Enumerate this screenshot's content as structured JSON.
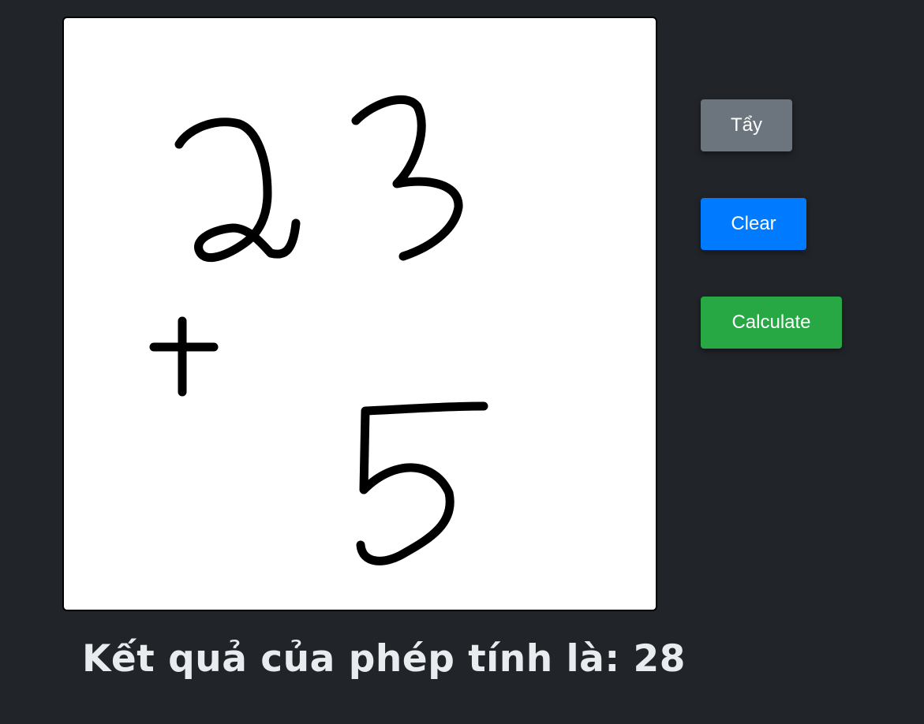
{
  "toolbar": {
    "eraser_label": "Tẩy",
    "clear_label": "Clear",
    "calculate_label": "Calculate"
  },
  "result": {
    "text": "Kết quả của phép tính là: 28"
  },
  "colors": {
    "background": "#212429",
    "canvas": "#ffffff",
    "ink": "#000000",
    "eraser_button": "#6c757d",
    "clear_button": "#007bff",
    "calculate_button": "#28a745",
    "result_text": "#e9ecef"
  },
  "icons": {
    "drawing_pen": "pen-icon"
  }
}
